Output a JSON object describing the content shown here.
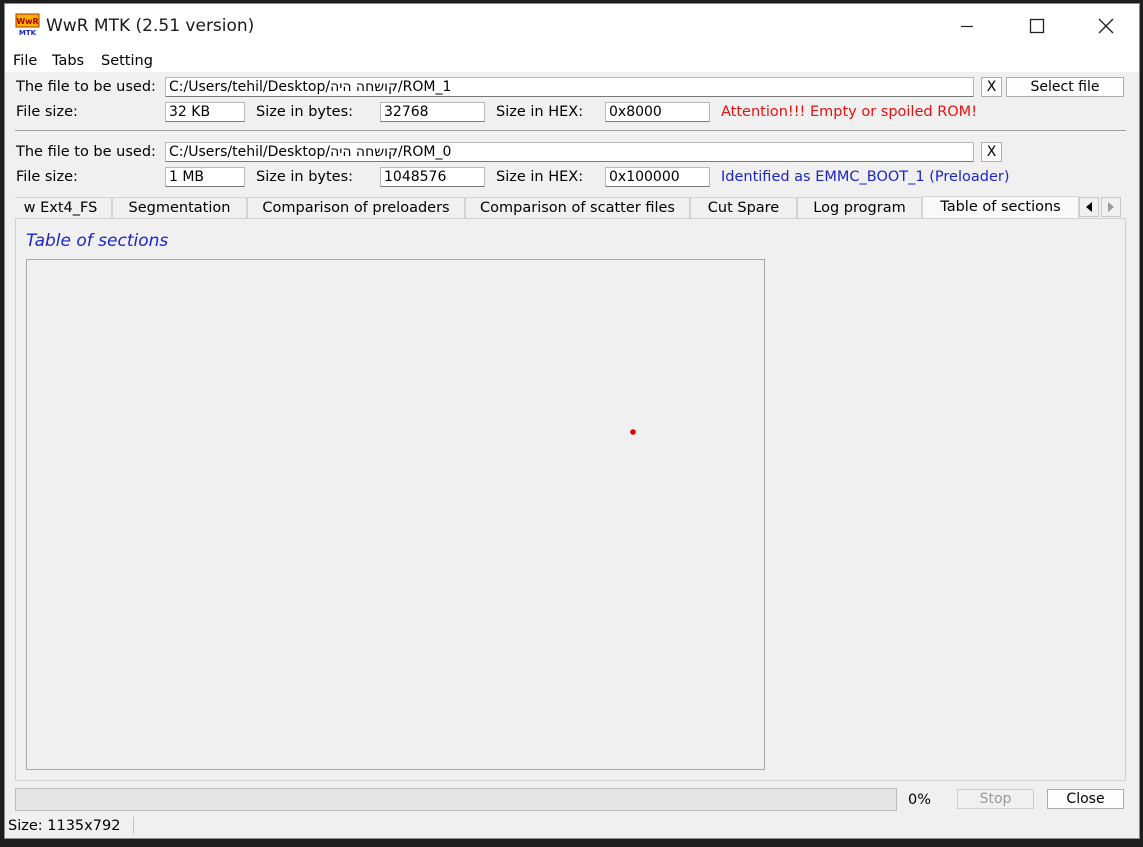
{
  "window": {
    "title": "WwR MTK (2.51 version)",
    "icon_text_top": "WwR",
    "icon_text_bottom": "MTK"
  },
  "menu": [
    "File",
    "Tabs",
    "Setting"
  ],
  "file1": {
    "label": "The file to be used:",
    "path": "C:/Users/tehil/Desktop/קושחה היה/ROM_1",
    "clear_label": "X",
    "select_label": "Select file",
    "size_label": "File size:",
    "size": "32 KB",
    "bytes_label": "Size in bytes:",
    "bytes": "32768",
    "hex_label": "Size in HEX:",
    "hex": "0x8000",
    "message": "Attention!!! Empty or spoiled ROM!",
    "message_color": "#e81010"
  },
  "file2": {
    "label": "The file to be used:",
    "path": "C:/Users/tehil/Desktop/קושחה היה/ROM_0",
    "clear_label": "X",
    "size_label": "File size:",
    "size": "1 MB",
    "bytes_label": "Size in bytes:",
    "bytes": "1048576",
    "hex_label": "Size in HEX:",
    "hex": "0x100000",
    "message": "Identified as EMMC_BOOT_1 (Preloader)",
    "message_color": "#1c25c8"
  },
  "tabs": [
    {
      "label": "w Ext4_FS",
      "active": false
    },
    {
      "label": "Segmentation",
      "active": false
    },
    {
      "label": "Comparison of preloaders",
      "active": false
    },
    {
      "label": "Comparison of scatter files",
      "active": false
    },
    {
      "label": "Cut Spare",
      "active": false
    },
    {
      "label": "Log program",
      "active": false
    },
    {
      "label": "Table of sections",
      "active": true
    }
  ],
  "panel": {
    "title": "Table of sections"
  },
  "progress": {
    "value": 0,
    "label": "0%"
  },
  "buttons": {
    "stop": "Stop",
    "close": "Close"
  },
  "status": {
    "size": "Size: 1135x792"
  }
}
